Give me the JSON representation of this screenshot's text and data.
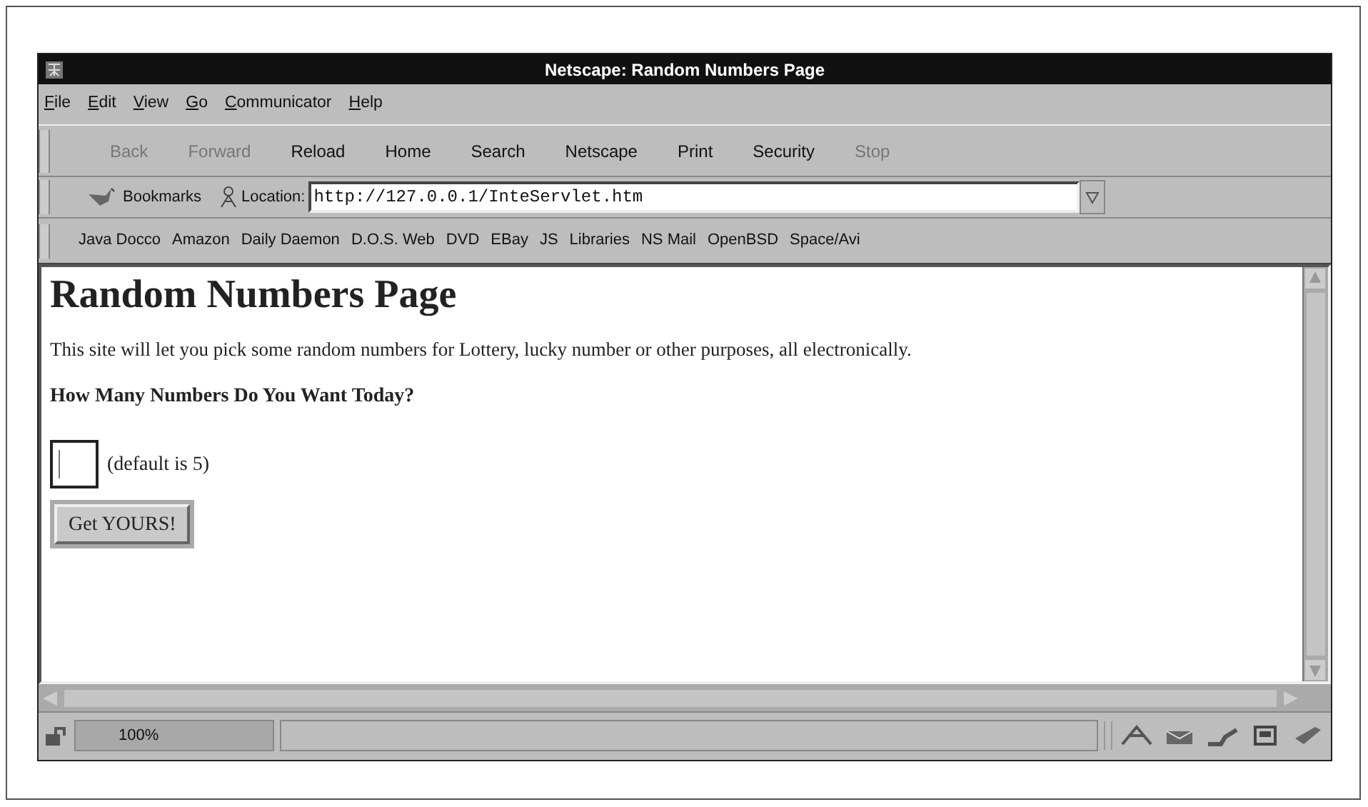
{
  "window": {
    "title": "Netscape: Random Numbers Page"
  },
  "menu": [
    "File",
    "Edit",
    "View",
    "Go",
    "Communicator",
    "Help"
  ],
  "toolbar": [
    {
      "label": "Back",
      "disabled": true
    },
    {
      "label": "Forward",
      "disabled": true
    },
    {
      "label": "Reload",
      "disabled": false
    },
    {
      "label": "Home",
      "disabled": false
    },
    {
      "label": "Search",
      "disabled": false
    },
    {
      "label": "Netscape",
      "disabled": false
    },
    {
      "label": "Print",
      "disabled": false
    },
    {
      "label": "Security",
      "disabled": false
    },
    {
      "label": "Stop",
      "disabled": true
    }
  ],
  "location_bar": {
    "bookmarks_label": "Bookmarks",
    "location_label": "Location:",
    "url": "http://127.0.0.1/InteServlet.htm"
  },
  "personal_toolbar": [
    "Java Docco",
    "Amazon",
    "Daily Daemon",
    "D.O.S. Web",
    "DVD",
    "EBay",
    "JS",
    "Libraries",
    "NS Mail",
    "OpenBSD",
    "Space/Avi"
  ],
  "page": {
    "heading": "Random Numbers Page",
    "intro": "This site will let you pick some random numbers for Lottery, lucky number or other purposes, all electronically.",
    "question": "How Many Numbers Do You Want Today?",
    "count_field": {
      "note": "(default is 5)"
    },
    "submit_button": "Get YOURS!"
  },
  "status_bar": {
    "progress_text": "100%"
  }
}
